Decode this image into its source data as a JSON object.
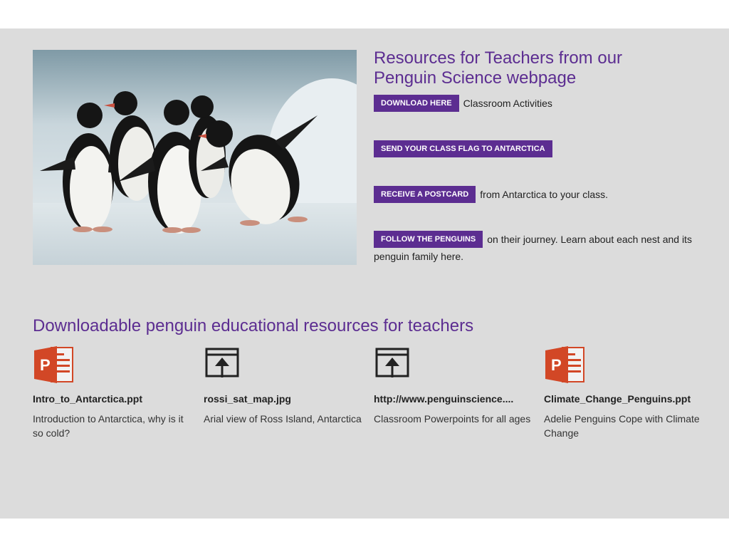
{
  "teachers": {
    "title": "Resources for Teachers from our Penguin Science webpage",
    "rows": [
      {
        "button": "DOWNLOAD HERE",
        "text": "Classroom Activities"
      },
      {
        "button": "SEND YOUR CLASS FLAG TO ANTARCTICA",
        "text": ""
      },
      {
        "button": "RECEIVE A POSTCARD",
        "text": "from Antarctica to your class."
      },
      {
        "button": "FOLLOW THE PENGUINS",
        "text": "on their journey. Learn about each nest and its penguin family here."
      }
    ]
  },
  "downloads": {
    "title": "Downloadable penguin educational resources for teachers",
    "items": [
      {
        "icon": "powerpoint-icon",
        "name": "Intro_to_Antarctica.ppt",
        "desc": "Introduction to Antarctica, why is it so cold?"
      },
      {
        "icon": "web-link-icon",
        "name": "rossi_sat_map.jpg",
        "desc": "Arial view of Ross Island, Antarctica"
      },
      {
        "icon": "web-link-icon",
        "name": "http://www.penguinscience....",
        "desc": "Classroom Powerpoints for all ages"
      },
      {
        "icon": "powerpoint-icon",
        "name": "Climate_Change_Penguins.ppt",
        "desc": "Adelie Penguins Cope with Climate Change"
      }
    ]
  },
  "colors": {
    "accent": "#5c2d91",
    "powerpoint": "#d24726",
    "panel": "#dcdcdc"
  }
}
